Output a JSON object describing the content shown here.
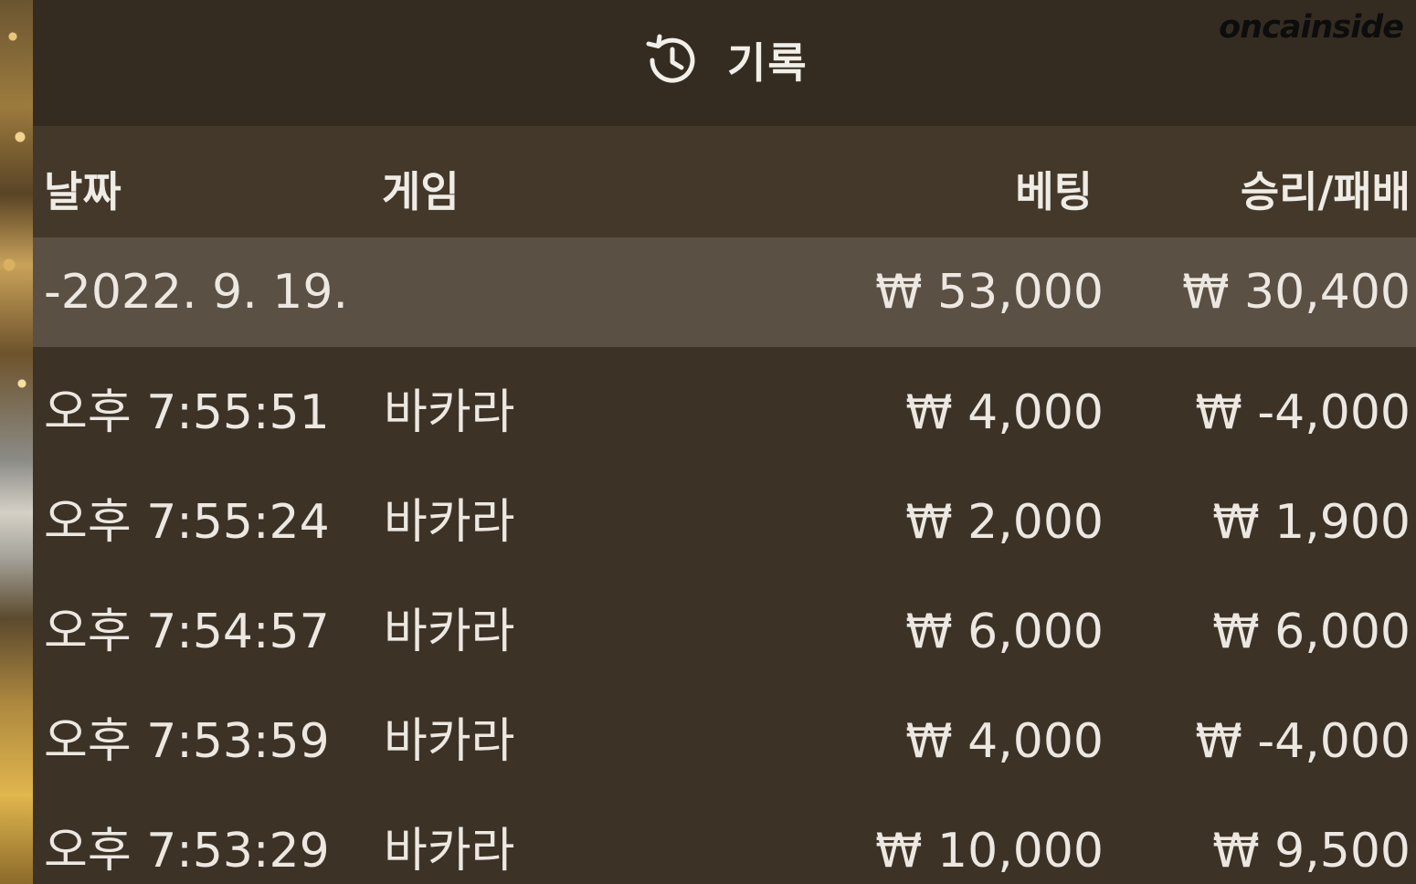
{
  "watermark": "oncainside",
  "header": {
    "icon": "history-icon",
    "title": "기록"
  },
  "columns": {
    "date": "날짜",
    "game": "게임",
    "bet": "베팅",
    "result": "승리/패배"
  },
  "summary": {
    "date": "-2022. 9. 19.",
    "bet": "₩ 53,000",
    "result": "₩ 30,400"
  },
  "rows": [
    {
      "time": "오후 7:55:51",
      "game": "바카라",
      "bet": "₩ 4,000",
      "result": "₩ -4,000"
    },
    {
      "time": "오후 7:55:24",
      "game": "바카라",
      "bet": "₩ 2,000",
      "result": "₩ 1,900"
    },
    {
      "time": "오후 7:54:57",
      "game": "바카라",
      "bet": "₩ 6,000",
      "result": "₩ 6,000"
    },
    {
      "time": "오후 7:53:59",
      "game": "바카라",
      "bet": "₩ 4,000",
      "result": "₩ -4,000"
    },
    {
      "time": "오후 7:53:29",
      "game": "바카라",
      "bet": "₩ 10,000",
      "result": "₩ 9,500"
    }
  ]
}
